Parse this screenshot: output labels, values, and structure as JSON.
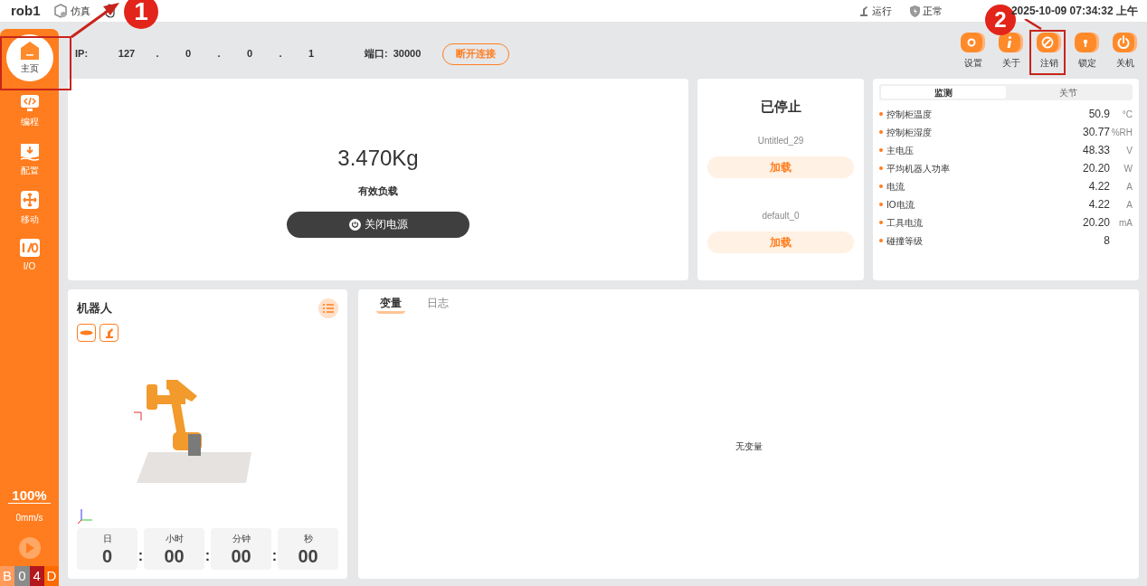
{
  "top_bar": {
    "title": "rob1",
    "mode": "仿真",
    "status_items": [
      {
        "kind": "robot",
        "label": "运行"
      },
      {
        "kind": "shield",
        "label": "正常"
      }
    ],
    "datetime": "2025-10-09 07:34:32 上午"
  },
  "connection": {
    "ip_label": "IP:",
    "ip_parts": [
      "127",
      "0",
      "0",
      "1"
    ],
    "ip_separator": ".",
    "port_label": "端口:",
    "port": "30000",
    "disconnect_button": "断开连接"
  },
  "toolbar": [
    {
      "kind": "settings",
      "label": "设置"
    },
    {
      "kind": "info",
      "label": "关于"
    },
    {
      "kind": "logout",
      "label": "注销"
    },
    {
      "kind": "lock",
      "label": "锁定"
    },
    {
      "kind": "power",
      "label": "关机"
    }
  ],
  "sidebar": {
    "items": [
      {
        "kind": "home",
        "label": "主页",
        "selected": true
      },
      {
        "kind": "code",
        "label": "编程",
        "selected": false
      },
      {
        "kind": "config",
        "label": "配置",
        "selected": false
      },
      {
        "kind": "move",
        "label": "移动",
        "selected": false
      },
      {
        "kind": "io",
        "label": "I/O",
        "selected": false
      }
    ],
    "speed": "100%",
    "velocity": "0mm/s",
    "status_chars": [
      {
        "char": "B",
        "color": "#ff9a5a"
      },
      {
        "char": "0",
        "color": "#8a8a8a"
      },
      {
        "char": "4",
        "color": "#b3161b"
      },
      {
        "char": "D",
        "color": "#ff6a00"
      }
    ]
  },
  "payload": {
    "value": "3.470Kg",
    "label": "有效负载",
    "button": "关闭电源"
  },
  "program": {
    "state": "已停止",
    "programs": [
      {
        "name": "Untitled_29",
        "button": "加载"
      },
      {
        "name": "default_0",
        "button": "加载"
      }
    ]
  },
  "monitor": {
    "tabs": [
      {
        "label": "监测",
        "selected": true
      },
      {
        "label": "关节",
        "selected": false
      }
    ],
    "rows": [
      {
        "label": "控制柜温度",
        "value": "50.9",
        "unit": "°C"
      },
      {
        "label": "控制柜湿度",
        "value": "30.77",
        "unit": "%RH"
      },
      {
        "label": "主电压",
        "value": "48.33",
        "unit": "V"
      },
      {
        "label": "平均机器人功率",
        "value": "20.20",
        "unit": "W"
      },
      {
        "label": "电流",
        "value": "4.22",
        "unit": "A"
      },
      {
        "label": "IO电流",
        "value": "4.22",
        "unit": "A"
      },
      {
        "label": "工具电流",
        "value": "20.20",
        "unit": "mA"
      },
      {
        "label": "碰撞等级",
        "value": "8"
      }
    ]
  },
  "robot": {
    "title": "机器人",
    "timer_separator": ":",
    "timer": [
      {
        "label": "日",
        "value": "0"
      },
      {
        "label": "小时",
        "value": "00"
      },
      {
        "label": "分钟",
        "value": "00"
      },
      {
        "label": "秒",
        "value": "00"
      }
    ]
  },
  "log": {
    "tabs": [
      {
        "label": "变量",
        "selected": true
      },
      {
        "label": "日志",
        "selected": false
      }
    ],
    "empty_text": "无变量"
  },
  "annotations": [
    {
      "number": "1"
    },
    {
      "number": "2"
    }
  ]
}
